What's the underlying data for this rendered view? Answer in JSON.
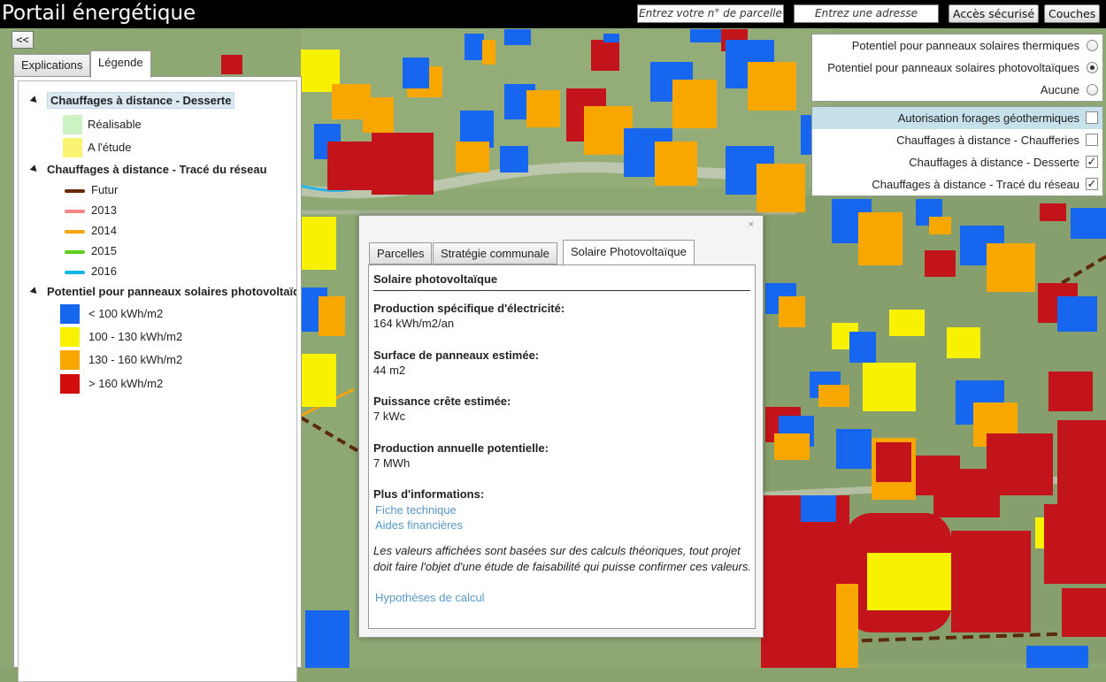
{
  "header": {
    "title": "Portail énergétique",
    "parcel_placeholder": "Entrez votre n° de parcelle",
    "address_placeholder": "Entrez une adresse",
    "secure_button": "Accès sécurisé",
    "layers_button": "Couches"
  },
  "left_panel": {
    "collapse_label": "<<",
    "tabs": [
      "Explications",
      "Légende"
    ],
    "active_tab": "Légende",
    "legend": {
      "group1": {
        "title": "Chauffages à distance - Desserte",
        "items": [
          {
            "label": "Réalisable",
            "color": "#ccf2c4"
          },
          {
            "label": "A l'étude",
            "color": "#fbf470"
          }
        ]
      },
      "group2": {
        "title": "Chauffages à distance - Tracé du réseau",
        "items": [
          {
            "label": "Futur",
            "color": "#6a2a08"
          },
          {
            "label": "2013",
            "color": "#f88484"
          },
          {
            "label": "2014",
            "color": "#f5a50a"
          },
          {
            "label": "2015",
            "color": "#5fcf1e"
          },
          {
            "label": "2016",
            "color": "#11b6e8"
          }
        ]
      },
      "group3": {
        "title": "Potentiel pour panneaux solaires photovoltaïques",
        "items": [
          {
            "label": "< 100 kWh/m2",
            "color": "#1766f0"
          },
          {
            "label": "100 - 130 kWh/m2",
            "color": "#f8f200"
          },
          {
            "label": "130 - 160 kWh/m2",
            "color": "#f8a700"
          },
          {
            "label": "> 160 kWh/m2",
            "color": "#d10c0c"
          }
        ]
      }
    }
  },
  "layers": {
    "radios": [
      {
        "label": "Potentiel pour panneaux solaires thermiques",
        "selected": false
      },
      {
        "label": "Potentiel pour panneaux solaires photovoltaïques",
        "selected": true
      },
      {
        "label": "Aucune",
        "selected": false
      }
    ],
    "checks": [
      {
        "label": "Autorisation forages géothermiques",
        "checked": false,
        "highlight": true
      },
      {
        "label": "Chauffages à distance - Chaufferies",
        "checked": false,
        "highlight": false
      },
      {
        "label": "Chauffages à distance - Desserte",
        "checked": true,
        "highlight": false
      },
      {
        "label": "Chauffages à distance - Tracé du réseau",
        "checked": true,
        "highlight": false
      }
    ]
  },
  "popup": {
    "close_icon": "×",
    "tabs": [
      "Parcelles",
      "Stratégie communale",
      "Solaire Photovoltaïque"
    ],
    "active_tab": "Solaire Photovoltaïque",
    "heading": "Solaire photovoltaïque",
    "fields": [
      {
        "label": "Production spécifique d'électricité:",
        "value": "164 kWh/m2/an"
      },
      {
        "label": "Surface de panneaux estimée:",
        "value": "44 m2"
      },
      {
        "label": "Puissance crête estimée:",
        "value": "7 kWc"
      },
      {
        "label": "Production annuelle potentielle:",
        "value": "7 MWh"
      }
    ],
    "more_info_label": "Plus d'informations:",
    "links": [
      "Fiche technique",
      "Aides financières"
    ],
    "note": "Les valeurs affichées sont basées sur des calculs théoriques, tout projet doit faire l'objet d'une étude de faisabilité qui puisse confirmer ces valeurs.",
    "hypotheses_link": "Hypothèses de calcul"
  }
}
